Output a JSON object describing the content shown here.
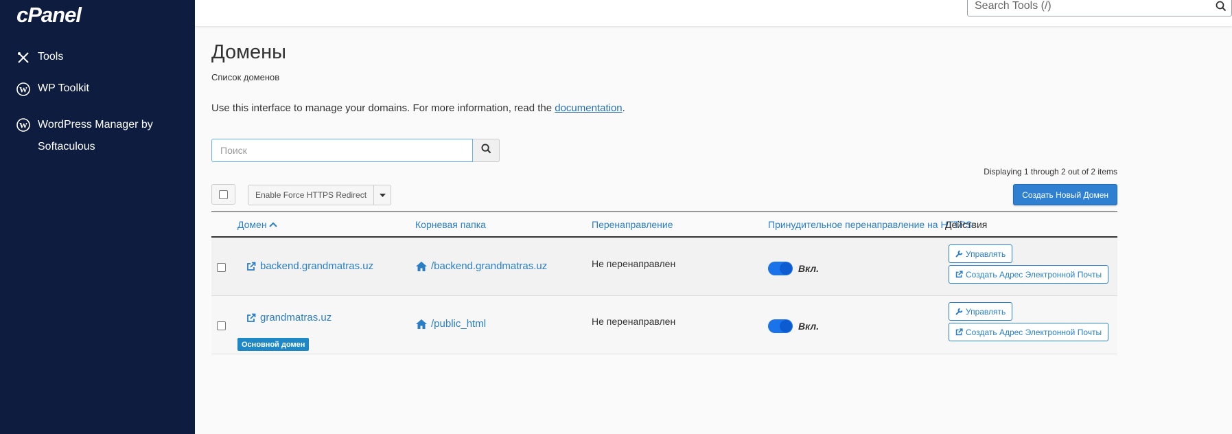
{
  "sidebar": {
    "logo": "cPanel",
    "items": [
      {
        "label": "Tools",
        "icon": "tools-icon"
      },
      {
        "label": "WP Toolkit",
        "icon": "wordpress-icon"
      },
      {
        "label": "WordPress Manager by Softaculous",
        "icon": "wordpress-icon"
      }
    ]
  },
  "topbar": {
    "search_placeholder": "Search Tools (/)"
  },
  "page": {
    "title": "Домены",
    "subtitle": "Список доменов",
    "description": "Use this interface to manage your domains. For more information, read the ",
    "doc_link": "documentation",
    "description_end": "."
  },
  "search": {
    "placeholder": "Поиск"
  },
  "toolbar": {
    "displaying": "Displaying 1 through 2 out of 2 items",
    "https_button": "Enable Force HTTPS Redirect",
    "create_button": "Создать Новый Домен"
  },
  "table": {
    "headers": {
      "domain": "Домен",
      "root": "Корневая папка",
      "redirect": "Перенаправление",
      "force_https": "Принудительное перенаправление на HTTPS",
      "actions": "Действия"
    },
    "rows": [
      {
        "domain": "backend.grandmatras.uz",
        "root": "/backend.grandmatras.uz",
        "redirect": "Не перенаправлен",
        "https_state": "Вкл.",
        "manage": "Управлять",
        "email": "Создать Адрес Электронной Почты"
      },
      {
        "domain": "grandmatras.uz",
        "badge": "Основной домен",
        "root": "/public_html",
        "redirect": "Не перенаправлен",
        "https_state": "Вкл.",
        "manage": "Управлять",
        "email": "Создать Адрес Электронной Почты"
      }
    ]
  },
  "colors": {
    "sidebar_bg": "#0e1d3f",
    "link": "#2a7ec6",
    "primary_button": "#2f80d0",
    "toggle_on": "#1a73e8",
    "badge": "#1e88c7"
  }
}
